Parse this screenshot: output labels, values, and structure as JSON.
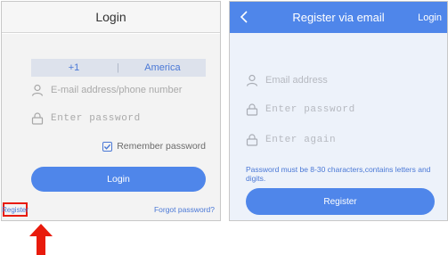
{
  "login_screen": {
    "title": "Login",
    "country_code": "+1",
    "separator": "|",
    "country": "America",
    "account_placeholder": "E-mail address/phone number",
    "password_placeholder": "Enter password",
    "remember_label": "Remember password",
    "remember_checked": true,
    "login_button": "Login",
    "register_link": "Register",
    "forgot_link": "Forgot password?"
  },
  "register_screen": {
    "title": "Register via email",
    "login_link": "Login",
    "email_placeholder": "Email address",
    "password_placeholder": "Enter password",
    "confirm_placeholder": "Enter again",
    "hint": "Password must be 8-30 characters,contains letters and digits.",
    "register_button": "Register"
  },
  "icons": {
    "back": "chevron-left-icon",
    "user": "user-icon",
    "lock": "lock-icon",
    "check": "check-icon",
    "arrow": "arrow-up-icon"
  },
  "colors": {
    "accent": "#4f86ea",
    "highlight": "#e81b0c",
    "link": "#4a78d6"
  }
}
